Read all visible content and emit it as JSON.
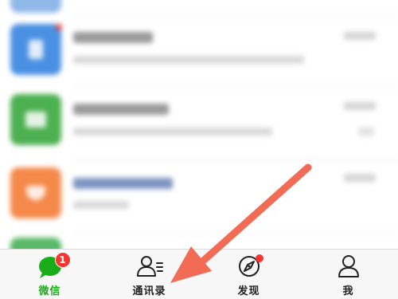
{
  "tabs": [
    {
      "label": "微信",
      "icon": "chat-bubble-icon",
      "active": true,
      "badge": "1"
    },
    {
      "label": "通讯录",
      "icon": "contacts-icon",
      "active": false
    },
    {
      "label": "发现",
      "icon": "compass-icon",
      "active": false,
      "dot": true
    },
    {
      "label": "我",
      "icon": "person-icon",
      "active": false
    }
  ],
  "colors": {
    "accent": "#1aad19",
    "badge": "#f43530",
    "arrow": "#f26b55",
    "avatar_blue": "#4a90e2",
    "avatar_green": "#4cb050",
    "avatar_orange": "#f5894a"
  }
}
